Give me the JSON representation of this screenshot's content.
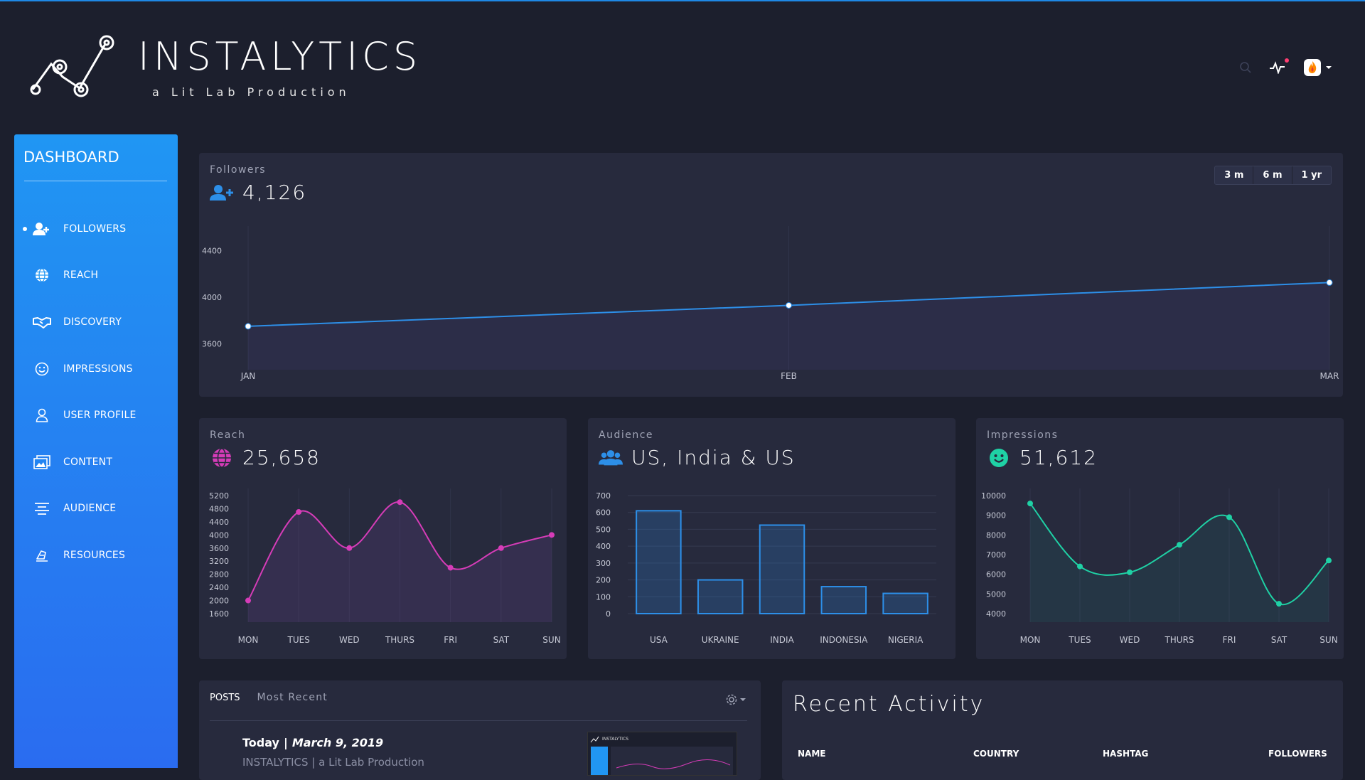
{
  "app": {
    "title": "INSTALYTICS",
    "subtitle": "a Lit Lab Production"
  },
  "header": {
    "icons": [
      "search-icon",
      "pulse-icon",
      "app-flame-icon",
      "caret-down-icon"
    ]
  },
  "sidebar": {
    "title": "DASHBOARD",
    "items": [
      {
        "label": "FOLLOWERS",
        "icon": "user-plus-icon",
        "active": true
      },
      {
        "label": "REACH",
        "icon": "globe-icon"
      },
      {
        "label": "DISCOVERY",
        "icon": "handshake-icon"
      },
      {
        "label": "IMPRESSIONS",
        "icon": "smile-icon"
      },
      {
        "label": "USER PROFILE",
        "icon": "user-icon"
      },
      {
        "label": "CONTENT",
        "icon": "images-icon"
      },
      {
        "label": "AUDIENCE",
        "icon": "align-icon"
      },
      {
        "label": "RESOURCES",
        "icon": "hand-icon"
      }
    ]
  },
  "followers": {
    "label": "Followers",
    "value": "4,126",
    "ranges": [
      "3 m",
      "6 m",
      "1 yr"
    ]
  },
  "reach": {
    "label": "Reach",
    "value": "25,658"
  },
  "audience": {
    "label": "Audience",
    "value": "US, India & US"
  },
  "impressions": {
    "label": "Impressions",
    "value": "51,612"
  },
  "posts": {
    "tab_posts": "POSTS",
    "tab_recent": "Most Recent",
    "date_prefix": "Today",
    "date_separator": "|",
    "date": "March 9, 2019",
    "subtitle": "INSTALYTICS | a Lit Lab Production",
    "thumb_title": "INSTALYTICS"
  },
  "activity": {
    "title": "Recent Activity",
    "columns": [
      "NAME",
      "COUNTRY",
      "HASHTAG",
      "FOLLOWERS"
    ]
  },
  "colors": {
    "background": "#1c1f2d",
    "card": "#272a3d",
    "accent_blue": "#2196f3",
    "line_blue": "#2d8fe8",
    "reach_magenta": "#d63cb8",
    "impressions_teal": "#1fd1a5"
  },
  "chart_data": [
    {
      "type": "line",
      "categories": [
        "JAN",
        "FEB",
        "MAR"
      ],
      "values": [
        3750,
        3930,
        4126
      ],
      "yticks": [
        3600,
        4000,
        4400
      ],
      "ylim": [
        3450,
        4550
      ]
    },
    {
      "type": "line",
      "categories": [
        "MON",
        "TUES",
        "WED",
        "THURS",
        "FRI",
        "SAT",
        "SUN"
      ],
      "values": [
        2000,
        4700,
        3600,
        5000,
        3000,
        3600,
        4000
      ],
      "yticks": [
        1600,
        2000,
        2400,
        2800,
        3200,
        3600,
        4000,
        4400,
        4800,
        5200
      ],
      "ylim": [
        1600,
        5200
      ]
    },
    {
      "type": "bar",
      "categories": [
        "USA",
        "UKRAINE",
        "INDIA",
        "INDONESIA",
        "NIGERIA"
      ],
      "values": [
        610,
        200,
        525,
        160,
        120
      ],
      "yticks": [
        0,
        100,
        200,
        300,
        400,
        500,
        600,
        700
      ],
      "ylim": [
        0,
        700
      ]
    },
    {
      "type": "line",
      "categories": [
        "MON",
        "TUES",
        "WED",
        "THURS",
        "FRI",
        "SAT",
        "SUN"
      ],
      "values": [
        9600,
        6400,
        6100,
        7500,
        8900,
        4500,
        6700
      ],
      "yticks": [
        4000,
        5000,
        6000,
        7000,
        8000,
        9000,
        10000
      ],
      "ylim": [
        4000,
        10000
      ]
    }
  ]
}
